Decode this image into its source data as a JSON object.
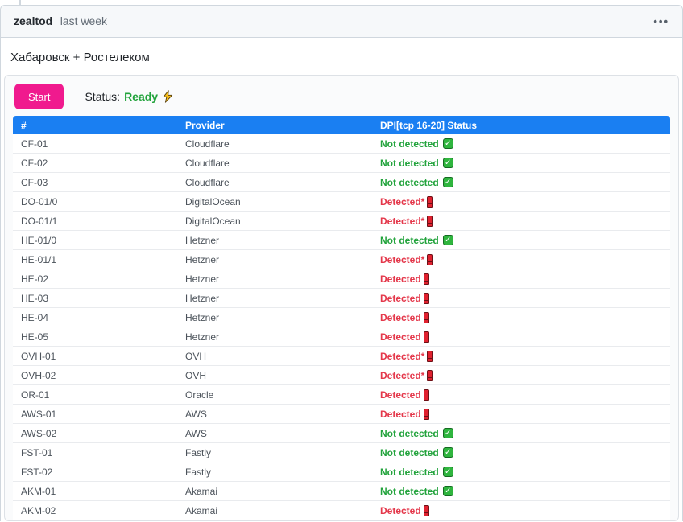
{
  "comment_header": {
    "author": "zealtod",
    "timestamp": "last week",
    "menu_icon": "kebab-menu-icon"
  },
  "post": {
    "title": "Хабаровск + Ростелеком"
  },
  "panel": {
    "start_button_label": "Start",
    "status_label": "Status:",
    "status_value": "Ready",
    "status_icon": "zap-icon"
  },
  "table": {
    "columns": [
      "#",
      "Provider",
      "DPI[tcp 16-20] Status"
    ],
    "rows": [
      {
        "id": "CF-01",
        "provider": "Cloudflare",
        "status": "Not detected",
        "icon": "check"
      },
      {
        "id": "CF-02",
        "provider": "Cloudflare",
        "status": "Not detected",
        "icon": "check"
      },
      {
        "id": "CF-03",
        "provider": "Cloudflare",
        "status": "Not detected",
        "icon": "check"
      },
      {
        "id": "DO-01/0",
        "provider": "DigitalOcean",
        "status": "Detected*",
        "icon": "exclamation"
      },
      {
        "id": "DO-01/1",
        "provider": "DigitalOcean",
        "status": "Detected*",
        "icon": "exclamation"
      },
      {
        "id": "HE-01/0",
        "provider": "Hetzner",
        "status": "Not detected",
        "icon": "check"
      },
      {
        "id": "HE-01/1",
        "provider": "Hetzner",
        "status": "Detected*",
        "icon": "exclamation"
      },
      {
        "id": "HE-02",
        "provider": "Hetzner",
        "status": "Detected",
        "icon": "exclamation"
      },
      {
        "id": "HE-03",
        "provider": "Hetzner",
        "status": "Detected",
        "icon": "exclamation"
      },
      {
        "id": "HE-04",
        "provider": "Hetzner",
        "status": "Detected",
        "icon": "exclamation"
      },
      {
        "id": "HE-05",
        "provider": "Hetzner",
        "status": "Detected",
        "icon": "exclamation"
      },
      {
        "id": "OVH-01",
        "provider": "OVH",
        "status": "Detected*",
        "icon": "exclamation"
      },
      {
        "id": "OVH-02",
        "provider": "OVH",
        "status": "Detected*",
        "icon": "exclamation"
      },
      {
        "id": "OR-01",
        "provider": "Oracle",
        "status": "Detected",
        "icon": "exclamation"
      },
      {
        "id": "AWS-01",
        "provider": "AWS",
        "status": "Detected",
        "icon": "exclamation"
      },
      {
        "id": "AWS-02",
        "provider": "AWS",
        "status": "Not detected",
        "icon": "check"
      },
      {
        "id": "FST-01",
        "provider": "Fastly",
        "status": "Not detected",
        "icon": "check"
      },
      {
        "id": "FST-02",
        "provider": "Fastly",
        "status": "Not detected",
        "icon": "check"
      },
      {
        "id": "AKM-01",
        "provider": "Akamai",
        "status": "Not detected",
        "icon": "check"
      },
      {
        "id": "AKM-02",
        "provider": "Akamai",
        "status": "Detected",
        "icon": "exclamation"
      }
    ]
  },
  "colors": {
    "table_header_blue": "#1a7ff2",
    "start_button_pink": "#f01a8e",
    "ok_green": "#22a33c",
    "alert_red": "#e4374a",
    "header_bg": "#f6f8fa",
    "border": "#d0d7de"
  }
}
